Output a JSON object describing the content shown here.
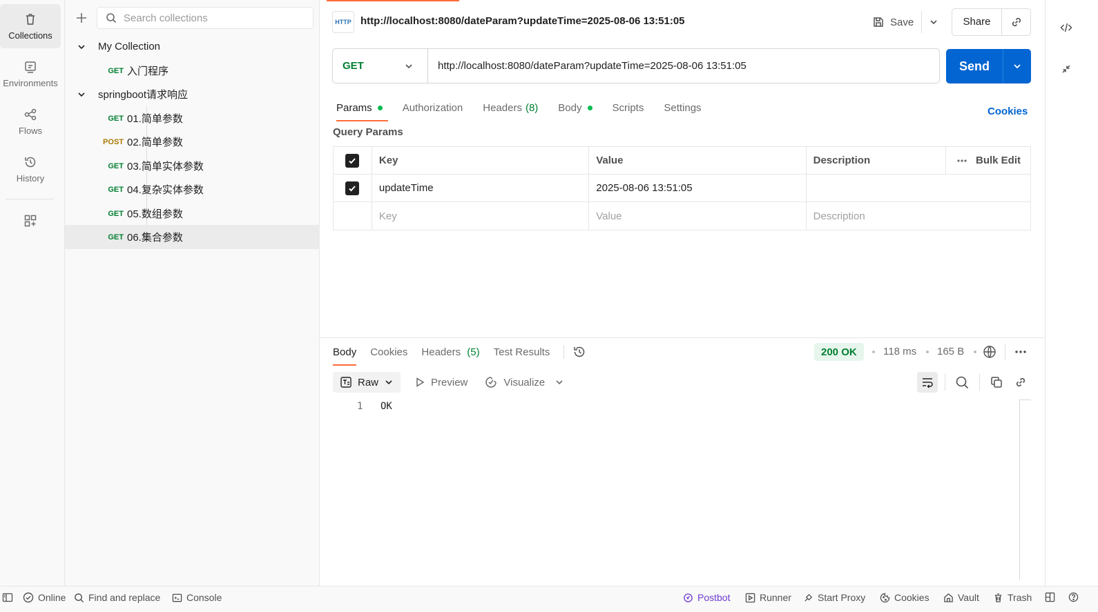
{
  "rail": {
    "items": [
      {
        "label": "Collections"
      },
      {
        "label": "Environments"
      },
      {
        "label": "Flows"
      },
      {
        "label": "History"
      }
    ]
  },
  "sidebar": {
    "search_placeholder": "Search collections",
    "tree": [
      {
        "label": "My Collection",
        "method": ""
      },
      {
        "label": "入门程序",
        "method": "GET"
      },
      {
        "label": "springboot请求响应",
        "method": ""
      },
      {
        "label": "01.简单参数",
        "method": "GET"
      },
      {
        "label": "02.简单参数",
        "method": "POST"
      },
      {
        "label": "03.简单实体参数",
        "method": "GET"
      },
      {
        "label": "04.复杂实体参数",
        "method": "GET"
      },
      {
        "label": "05.数组参数",
        "method": "GET"
      },
      {
        "label": "06.集合参数",
        "method": "GET"
      }
    ]
  },
  "header": {
    "http_badge": "HTTP",
    "title": "http://localhost:8080/dateParam?updateTime=2025-08-06 13:51:05",
    "save_label": "Save",
    "share_label": "Share"
  },
  "request": {
    "method": "GET",
    "url": "http://localhost:8080/dateParam?updateTime=2025-08-06 13:51:05",
    "send_label": "Send",
    "tabs": [
      {
        "label": "Params"
      },
      {
        "label": "Authorization"
      },
      {
        "label": "Headers",
        "count": "(8)"
      },
      {
        "label": "Body"
      },
      {
        "label": "Scripts"
      },
      {
        "label": "Settings"
      }
    ],
    "cookies_label": "Cookies",
    "query_params_title": "Query Params",
    "columns": {
      "key": "Key",
      "value": "Value",
      "description": "Description",
      "bulk_edit": "Bulk Edit"
    },
    "params": [
      {
        "key": "updateTime",
        "value": "2025-08-06 13:51:05",
        "description": ""
      }
    ],
    "placeholders": {
      "key": "Key",
      "value": "Value",
      "description": "Description"
    }
  },
  "response": {
    "tabs": [
      {
        "label": "Body"
      },
      {
        "label": "Cookies"
      },
      {
        "label": "Headers",
        "count": "(5)"
      },
      {
        "label": "Test Results"
      }
    ],
    "status": "200 OK",
    "time": "118 ms",
    "size": "165 B",
    "format": "Raw",
    "preview_label": "Preview",
    "visualize_label": "Visualize",
    "lines": [
      {
        "num": "1",
        "text": "OK"
      }
    ]
  },
  "footer": {
    "online": "Online",
    "find_replace": "Find and replace",
    "console": "Console",
    "postbot": "Postbot",
    "runner": "Runner",
    "start_proxy": "Start Proxy",
    "cookies": "Cookies",
    "vault": "Vault",
    "trash": "Trash"
  },
  "colors": {
    "accent": "#ff6c37",
    "send": "#0265d2",
    "get": "#007f31",
    "post": "#ad7a03",
    "postbot": "#6e3cd0"
  }
}
